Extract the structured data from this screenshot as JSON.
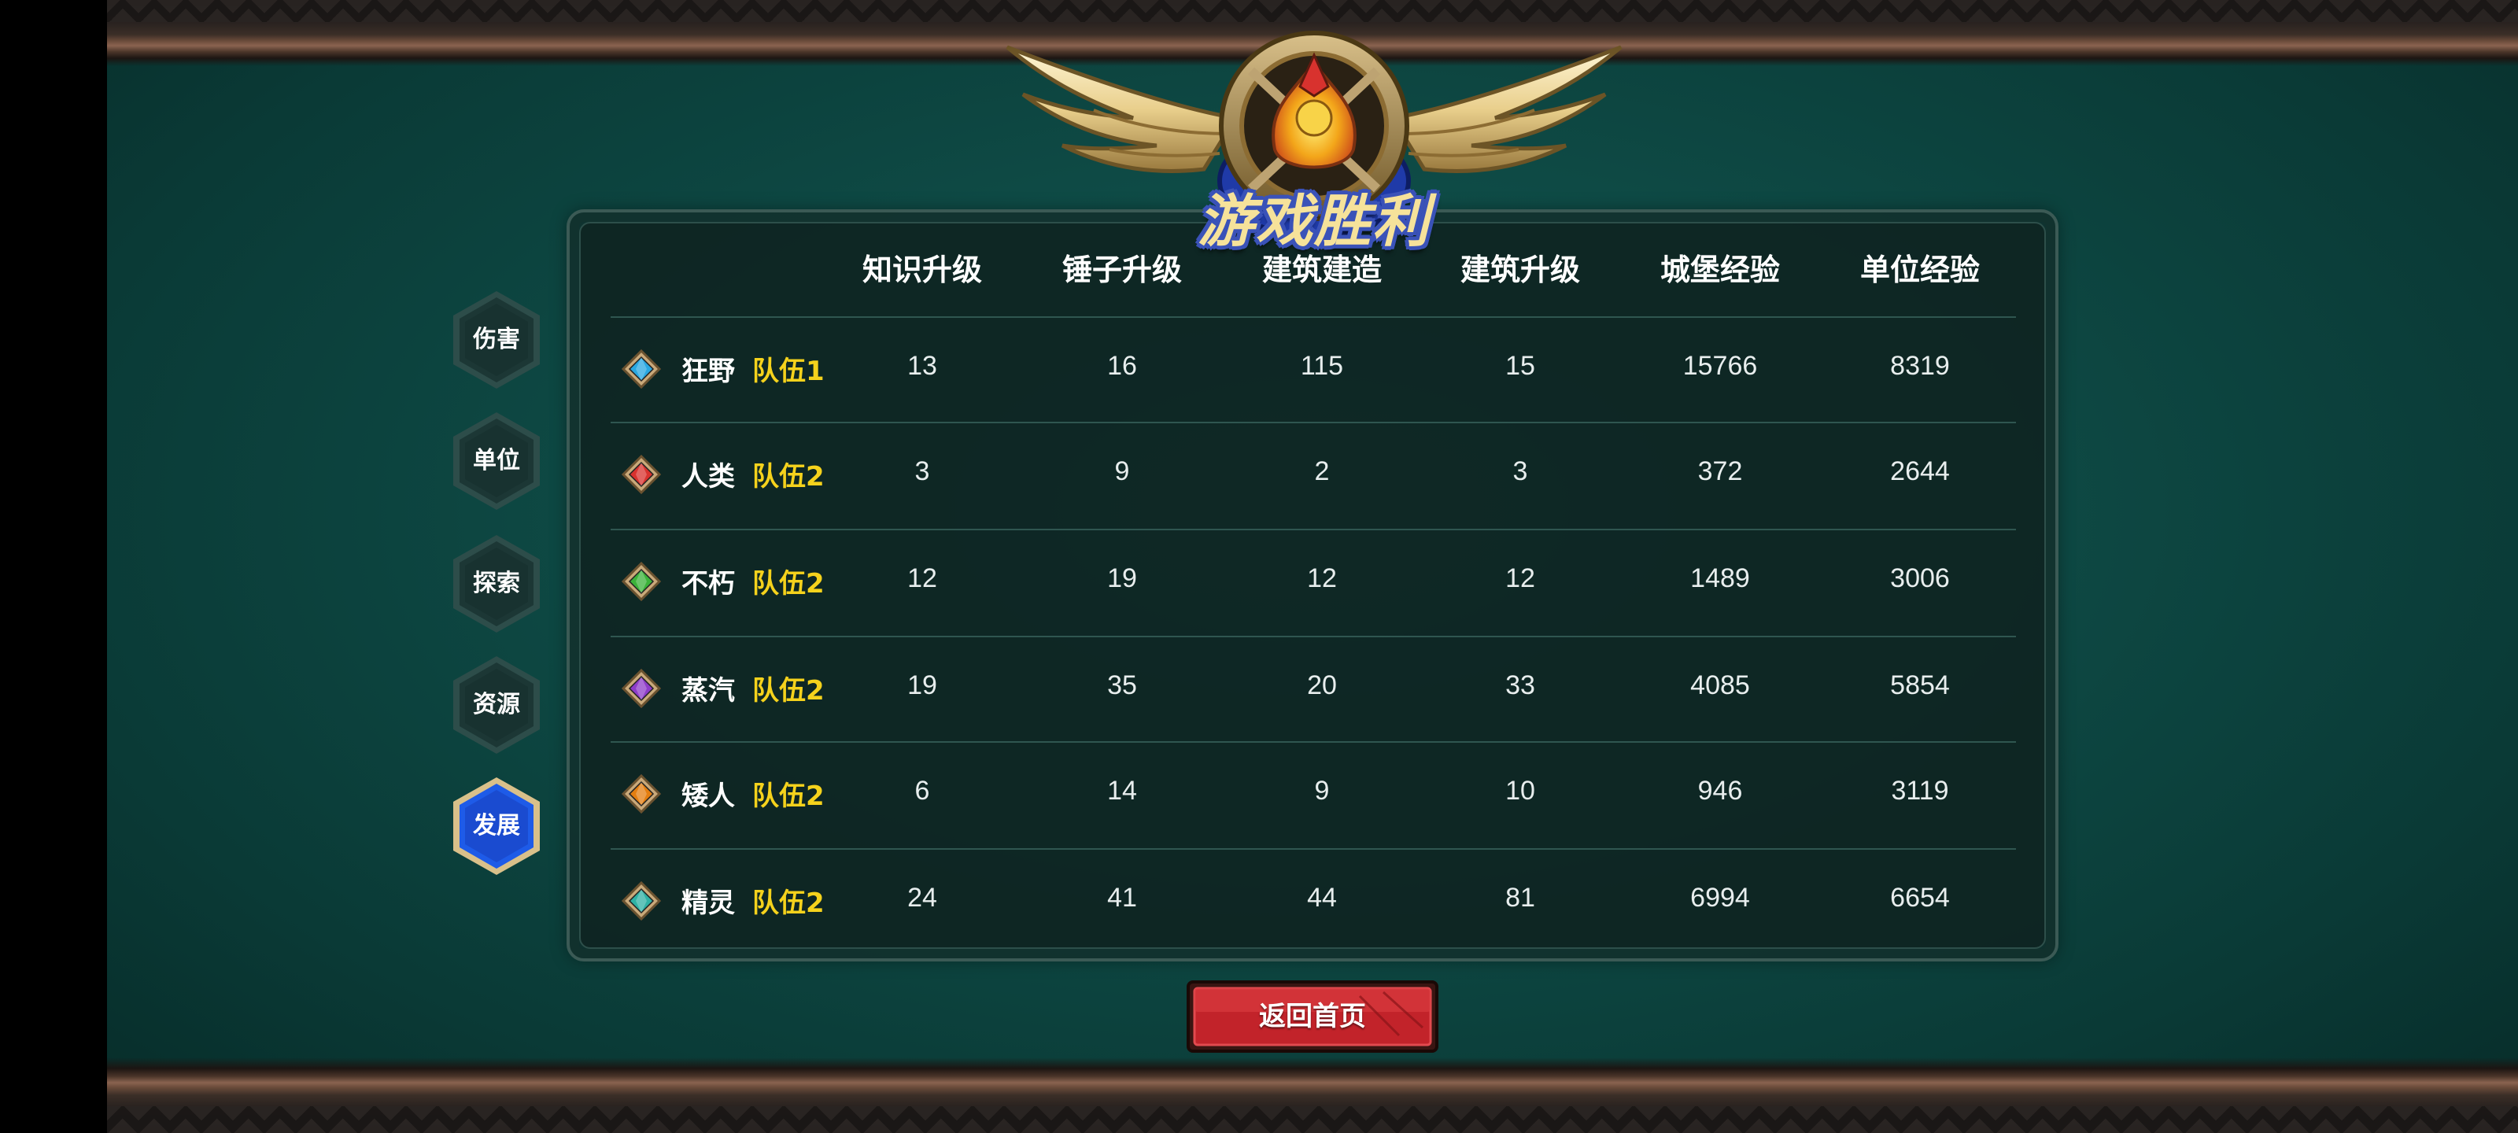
{
  "screen": {
    "title": "游戏胜利",
    "return_button": "返回首页"
  },
  "tabs": [
    {
      "label": "伤害",
      "active": false
    },
    {
      "label": "单位",
      "active": false
    },
    {
      "label": "探索",
      "active": false
    },
    {
      "label": "资源",
      "active": false
    },
    {
      "label": "发展",
      "active": true
    }
  ],
  "table": {
    "columns": [
      "知识升级",
      "锤子升级",
      "建筑建造",
      "建筑升级",
      "城堡经验",
      "单位经验"
    ],
    "rows": [
      {
        "gem_color": "#2aa7e0",
        "race": "狂野",
        "team": "队伍1",
        "values": [
          "13",
          "16",
          "115",
          "15",
          "15766",
          "8319"
        ]
      },
      {
        "gem_color": "#d8322e",
        "race": "人类",
        "team": "队伍2",
        "values": [
          "3",
          "9",
          "2",
          "3",
          "372",
          "2644"
        ]
      },
      {
        "gem_color": "#3bb23a",
        "race": "不朽",
        "team": "队伍2",
        "values": [
          "12",
          "19",
          "12",
          "12",
          "1489",
          "3006"
        ]
      },
      {
        "gem_color": "#8e3cc8",
        "race": "蒸汽",
        "team": "队伍2",
        "values": [
          "19",
          "35",
          "20",
          "33",
          "4085",
          "5854"
        ]
      },
      {
        "gem_color": "#e47e10",
        "race": "矮人",
        "team": "队伍2",
        "values": [
          "6",
          "14",
          "9",
          "10",
          "946",
          "3119"
        ]
      },
      {
        "gem_color": "#2fb1a4",
        "race": "精灵",
        "team": "队伍2",
        "values": [
          "24",
          "41",
          "44",
          "81",
          "6994",
          "6654"
        ]
      }
    ]
  },
  "colors": {
    "team_text": "#f5d21c",
    "active_tab": "#1e5be8",
    "inactive_tab": "#1c3735",
    "button_red": "#c2232a"
  },
  "icons": {
    "emblem": "winged-crest-emblem",
    "row_marker": "diamond-gem-icon"
  }
}
